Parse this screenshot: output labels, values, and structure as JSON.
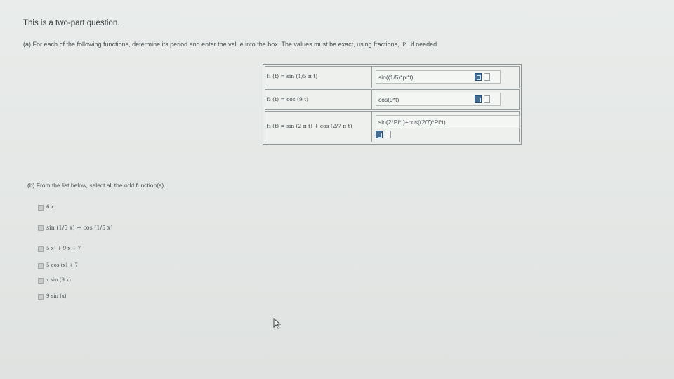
{
  "intro": "This is a two-part question.",
  "part_a": {
    "text": "(a) For each of the following functions, determine its period and enter the value into the box. The values must be exact, using fractions,",
    "pi_symbol": "Pi",
    "text_end": "if needed.",
    "rows": [
      {
        "function": "f₁ (t) = sin (1/5 π t)",
        "answer": "sin((1/5)*pi*t)"
      },
      {
        "function": "f₂ (t) = cos (9 t)",
        "answer": "cos(9*t)"
      },
      {
        "function": "f₃ (t) = sin (2 π t) + cos (2/7 π t)",
        "answer": "sin(2*Pi*t)+cos((2/7)*Pi*t)"
      }
    ]
  },
  "part_b": {
    "text": "(b) From the list below, select all the odd function(s).",
    "options": [
      "6 x",
      "sin (1/5 x) + cos (1/5 x)",
      "5 x⁷ + 9 x + 7",
      "5 cos (x) + 7",
      "x sin (9 x)",
      "9 sin (x)"
    ]
  },
  "icons": {
    "preview": "preview-icon",
    "help": "help-doc-icon",
    "cursor": "mouse-cursor-icon"
  }
}
